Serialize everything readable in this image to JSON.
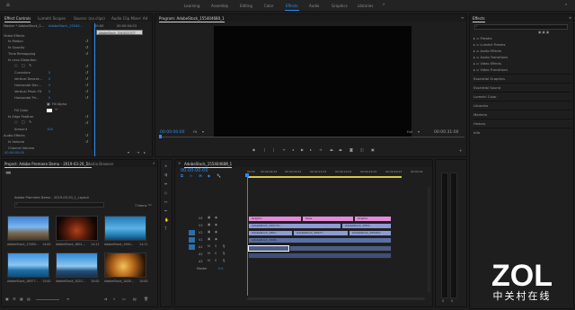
{
  "workspaces": [
    "Learning",
    "Assembly",
    "Editing",
    "Color",
    "Effects",
    "Audio",
    "Graphics",
    "Libraries"
  ],
  "active_workspace": "Effects",
  "source_tabs": [
    "Effect Controls",
    "Lumetri Scopes",
    "Source: (no clips)",
    "Audio Clip Mixer: Ad"
  ],
  "ec": {
    "master": "Master * AdobeStock_1...",
    "clip": "AdobeStock_15540...",
    "time": "00:00",
    "time2": "00:00:04:23",
    "mini_clip": "AdobeStock_1540021577",
    "rows": [
      "Video Effects",
      "fx Motion",
      "fx Opacity",
      "Time Remapping",
      "fx Lens Distortion",
      "Curvature",
      "Vertical Decent...",
      "Horizontal Dec...",
      "Vertical Prism FX",
      "Horizontal Pri...",
      "Fill Alpha",
      "Fill Color",
      "fx Edge Feather",
      "Amount",
      "Audio Effects",
      "fx Volume",
      "Channel Volume"
    ],
    "values": [
      "0",
      "0",
      "0",
      "0",
      "0",
      "",
      "",
      "",
      "100"
    ],
    "fill_alpha": "Fill Alpha",
    "timecode": "00:00:00:00"
  },
  "program": {
    "tab": "Program: AdobeStock_155404680_1",
    "tc_left": "00:00:00:00",
    "fit": "Fit",
    "full": "Full",
    "tc_right": "00:00:31:00"
  },
  "project": {
    "tabs": [
      "Project: Adobe Premiere Demo - 2019-03-20_1...",
      "Media Browser"
    ],
    "path": "Adobe Premiere Demo - 2019-03-20_1_Layout",
    "items_count": "7 Items",
    "items": [
      {
        "name": "AdobeStock_17489...",
        "dur": "14:00"
      },
      {
        "name": "AdobeStock_1801...",
        "dur": "14:11"
      },
      {
        "name": "AdobeStock_1940...",
        "dur": "14:11"
      },
      {
        "name": "AdobeStock_16977...",
        "dur": "15:00"
      },
      {
        "name": "AdobeStock_1020...",
        "dur": "10:00"
      },
      {
        "name": "AdobeStock_1008...",
        "dur": "10:00"
      }
    ]
  },
  "timeline": {
    "tab": "AdobeStock_155404680_1",
    "tc": "00:00:00:00",
    "ruler": [
      "00:00",
      "00:00:04:23",
      "00:00:09:23",
      "00:00:14:23",
      "00:00:19:23",
      "00:00:24:23",
      "00:00:29:23",
      "00:00:34"
    ],
    "tracks": [
      "V4",
      "V3",
      "V2",
      "V1",
      "A1",
      "A2",
      "A3",
      "Master"
    ],
    "master_val": "0.0",
    "clips": [
      {
        "label": "Graphic",
        "color": "#e58ad8"
      },
      {
        "label": "Slow",
        "color": "#e58ad8"
      },
      {
        "label": "Graphic",
        "color": "#e58ad8"
      },
      {
        "label": "AdobeStock_155770..",
        "color": "#8f9bd6"
      },
      {
        "label": "AdobeStock_1554..",
        "color": "#8f9bd6"
      },
      {
        "label": "AdobeStock_1801..",
        "color": "#8f9bd6"
      },
      {
        "label": "AdobeStock_16977..",
        "color": "#8f9bd6"
      },
      {
        "label": "AdobeStock_155404..",
        "color": "#8f9bd6"
      },
      {
        "label": "AdobeStock_1548..",
        "color": "#8f9bd6"
      }
    ]
  },
  "effects": {
    "tab": "Effects",
    "search_placeholder": "",
    "tree": [
      "Presets",
      "Lumetri Presets",
      "Audio Effects",
      "Audio Transitions",
      "Video Effects",
      "Video Transitions"
    ],
    "panels": [
      "Essential Graphics",
      "Essential Sound",
      "Lumetri Color",
      "Libraries",
      "Markers",
      "History",
      "Info"
    ]
  },
  "watermark": {
    "brand": "ZOL",
    "sub": "中关村在线"
  }
}
